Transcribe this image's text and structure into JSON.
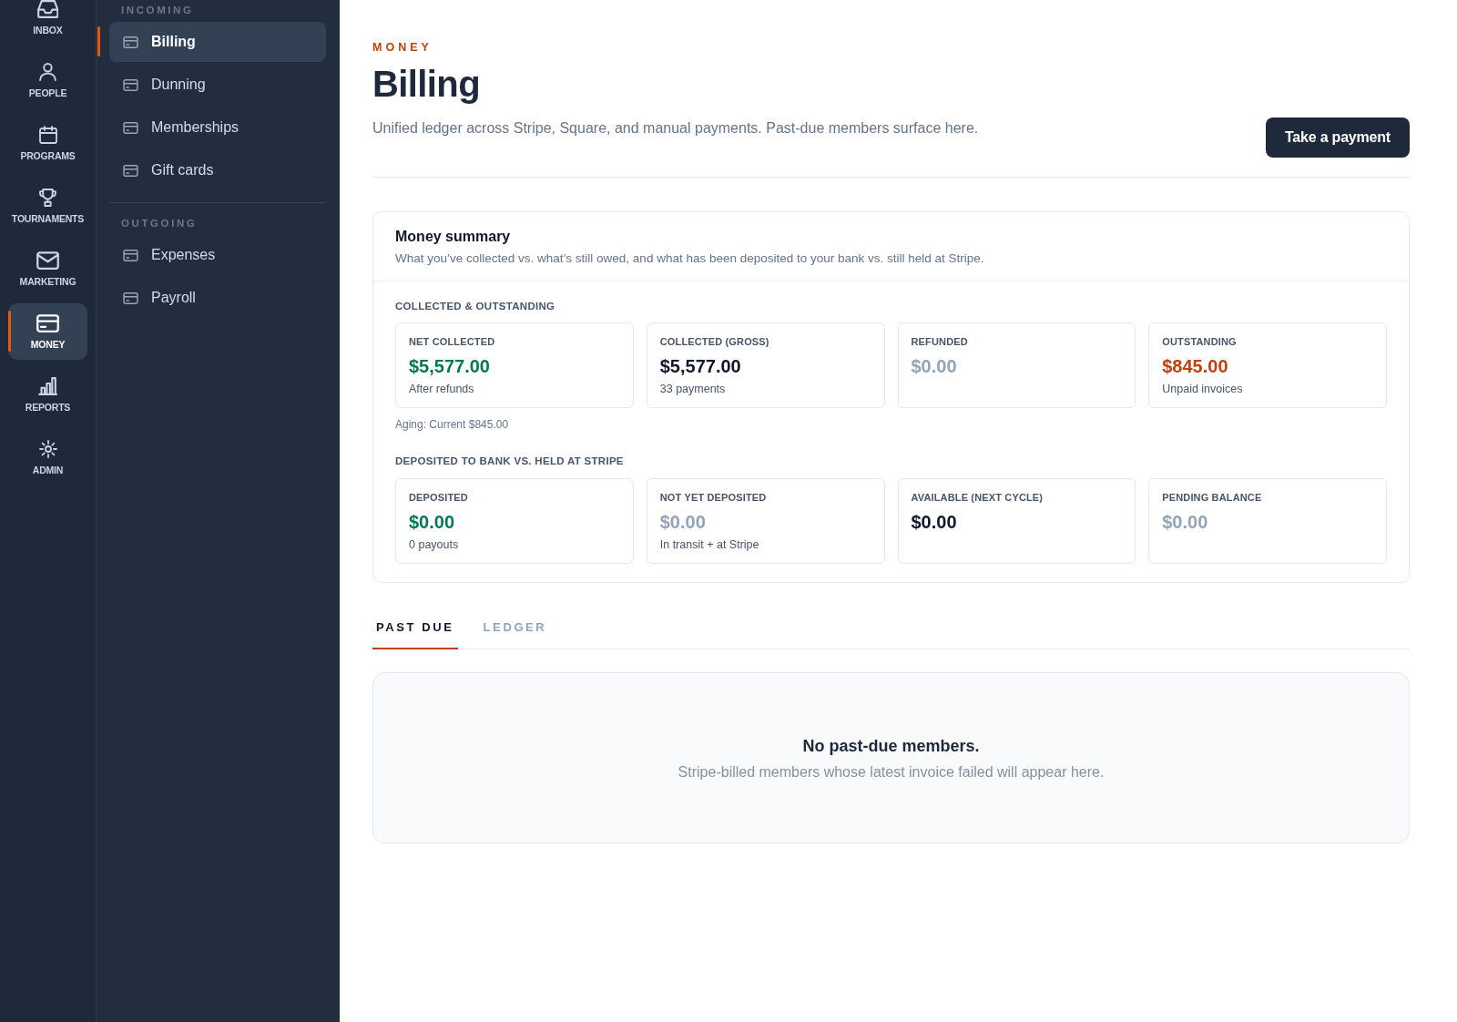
{
  "rail": {
    "items": [
      {
        "kind": "inbox",
        "label": "INBOX",
        "selected": false
      },
      {
        "kind": "people",
        "label": "PEOPLE",
        "selected": false
      },
      {
        "kind": "programs",
        "label": "PROGRAMS",
        "selected": false
      },
      {
        "kind": "tournaments",
        "label": "TOURNAMENTS",
        "selected": false
      },
      {
        "kind": "marketing",
        "label": "MARKETING",
        "selected": false
      },
      {
        "kind": "money",
        "label": "MONEY",
        "selected": true
      },
      {
        "kind": "reports",
        "label": "REPORTS",
        "selected": false
      },
      {
        "kind": "admin",
        "label": "ADMIN",
        "selected": false
      }
    ]
  },
  "sidebar": {
    "sections": [
      {
        "heading": "INCOMING",
        "items": [
          {
            "label": "Billing",
            "selected": true
          },
          {
            "label": "Dunning",
            "selected": false
          },
          {
            "label": "Memberships",
            "selected": false
          },
          {
            "label": "Gift cards",
            "selected": false
          }
        ]
      },
      {
        "heading": "OUTGOING",
        "items": [
          {
            "label": "Expenses",
            "selected": false
          },
          {
            "label": "Payroll",
            "selected": false
          }
        ]
      }
    ]
  },
  "header": {
    "eyebrow": "MONEY",
    "title": "Billing",
    "subtitle": "Unified ledger across Stripe, Square, and manual payments. Past-due members surface here.",
    "action": "Take a payment"
  },
  "money_summary": {
    "title": "Money summary",
    "description": "What you’ve collected vs. what’s still owed, and what has been deposited to your bank vs. still held at Stripe.",
    "groups": [
      {
        "heading": "COLLECTED & OUTSTANDING",
        "stats": [
          {
            "label": "NET COLLECTED",
            "value": "$5,577.00",
            "color": "#047857",
            "note": "After refunds"
          },
          {
            "label": "COLLECTED (GROSS)",
            "value": "$5,577.00",
            "color": "#0f172a",
            "note": "33 payments"
          },
          {
            "label": "REFUNDED",
            "value": "$0.00",
            "color": "#94a3b8"
          },
          {
            "label": "OUTSTANDING",
            "value": "$845.00",
            "color": "#c2410c",
            "note": "Unpaid invoices"
          }
        ],
        "footnote": "Aging: Current $845.00"
      },
      {
        "heading": "DEPOSITED TO BANK VS. HELD AT STRIPE",
        "stats": [
          {
            "label": "DEPOSITED",
            "value": "$0.00",
            "color": "#047857",
            "note": "0 payouts"
          },
          {
            "label": "NOT YET DEPOSITED",
            "value": "$0.00",
            "color": "#94a3b8",
            "note": "In transit + at Stripe"
          },
          {
            "label": "AVAILABLE (NEXT CYCLE)",
            "value": "$0.00",
            "color": "#0f172a"
          },
          {
            "label": "PENDING BALANCE",
            "value": "$0.00",
            "color": "#94a3b8"
          }
        ]
      }
    ]
  },
  "tabs": [
    {
      "label": "PAST DUE",
      "selected": true
    },
    {
      "label": "LEDGER",
      "selected": false
    }
  ],
  "empty_state": {
    "title": "No past-due members.",
    "message": "Stripe-billed members whose latest invoice failed will appear here."
  }
}
